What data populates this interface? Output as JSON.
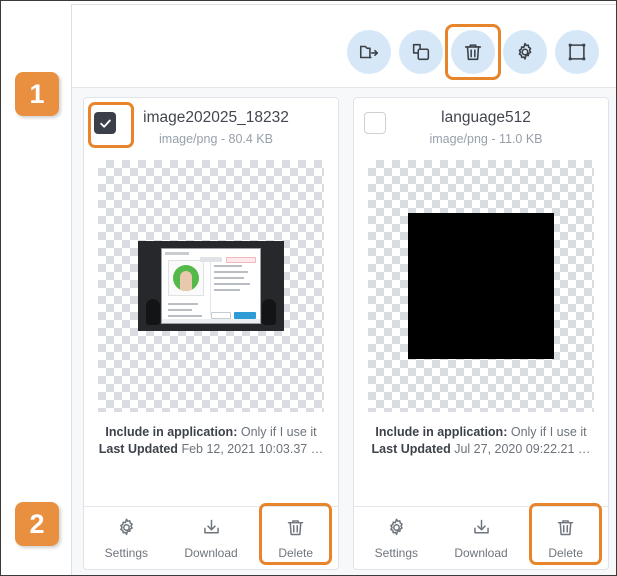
{
  "app": {
    "background_color": "#ffffff",
    "panel_background": "#f6f8fa",
    "accent_color": "#e8852c",
    "toolbar_icon_bg": "#d6e8f7"
  },
  "toolbar": {
    "buttons": [
      {
        "name": "move-to-folder",
        "icon": "folder-arrow-icon",
        "highlighted": false
      },
      {
        "name": "duplicate",
        "icon": "copy-icon",
        "highlighted": false
      },
      {
        "name": "delete",
        "icon": "trash-icon",
        "highlighted": true
      },
      {
        "name": "settings",
        "icon": "gear-icon",
        "highlighted": false
      },
      {
        "name": "resize",
        "icon": "crop-frame-icon",
        "highlighted": false
      }
    ]
  },
  "annotations": {
    "step_1": "1",
    "step_2": "2"
  },
  "labels": {
    "include_in_application": "Include in application:",
    "last_updated": "Last Updated"
  },
  "actions": {
    "settings": "Settings",
    "download": "Download",
    "delete": "Delete"
  },
  "cards": [
    {
      "file_name": "image202025_18232",
      "file_meta": "image/png - 80.4 KB",
      "checkbox_checked": true,
      "checkbox_highlighted": true,
      "include_in_application_value": "Only if I use it",
      "last_updated_value": "Feb 12, 2021 10:03.37 …",
      "thumbnail_type": "screenshot",
      "delete_highlighted": true
    },
    {
      "file_name": "language512",
      "file_meta": "image/png - 11.0 KB",
      "checkbox_checked": false,
      "checkbox_highlighted": false,
      "include_in_application_value": "Only if I use it",
      "last_updated_value": "Jul 27, 2020 09:22.21 …",
      "thumbnail_type": "black-square",
      "delete_highlighted": true
    }
  ]
}
